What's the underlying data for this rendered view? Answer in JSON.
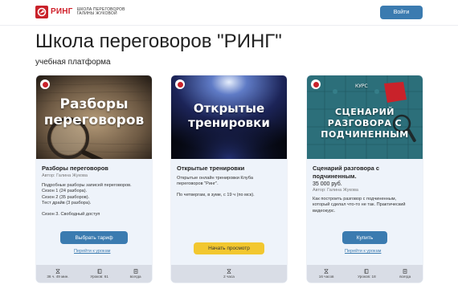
{
  "header": {
    "logo_main": "РИНГ",
    "logo_sub_line1": "ШКОЛА ПЕРЕГОВОРОВ",
    "logo_sub_line2": "ГАЛИНЫ ЖУКОВОЙ",
    "login_label": "Войти"
  },
  "page": {
    "title": "Школа переговоров \"РИНГ\"",
    "subtitle": "учебная платформа"
  },
  "cards": [
    {
      "cover_line1": "Разборы",
      "cover_line2": "переговоров",
      "title": "Разборы переговоров",
      "author": "Автор: Галина Жукова",
      "desc_lines": [
        "Подробные разборы записей переговоров.",
        "Сезон 1 (24 разбора).",
        "Сезон 2 (35 разборов).",
        "Тест драйв (3 разбора)."
      ],
      "desc_extra": "Сезон 3. Свободный доступ",
      "button_label": "Выбрать тариф",
      "link_label": "Перейти к урокам",
      "stats": [
        {
          "icon": "hourglass-icon",
          "label": "36 ч. 49 мин."
        },
        {
          "icon": "book-icon",
          "label": "Уроков: 61"
        },
        {
          "icon": "infinity-icon",
          "label": "всегда"
        }
      ]
    },
    {
      "cover_line1": "Открытые",
      "cover_line2": "тренировки",
      "title": "Открытые тренировки",
      "desc_lines": [
        "Открытые онлайн тренировки Клуба",
        "переговоров \"Ринг\"."
      ],
      "desc_extra": "По четвергам, в зуме, с 19 ч (по мск).",
      "button_label": "Начать просмотр",
      "stats": [
        {
          "icon": "hourglass-icon",
          "label": "2 часа"
        }
      ]
    },
    {
      "cover_badge": "КУРС",
      "cover_line1": "СЦЕНАРИЙ",
      "cover_line2": "РАЗГОВОРА С",
      "cover_line3": "ПОДЧИНЕННЫМ",
      "title_line1": "Сценарий разговора с",
      "title_line2": "подчиненным.",
      "price": "35 000 руб.",
      "author": "Автор: Галина Жукова",
      "desc_lines": [
        "Как построить разговор с подчиненным,",
        "который сделал что-то не так. Практический",
        "видеокурс."
      ],
      "button_label": "Купить",
      "link_label": "Перейти к урокам",
      "stats": [
        {
          "icon": "hourglass-icon",
          "label": "16 часов"
        },
        {
          "icon": "book-icon",
          "label": "Уроков: 18"
        },
        {
          "icon": "infinity-icon",
          "label": "всегда"
        }
      ]
    }
  ],
  "colors": {
    "accent": "#3b7bb0",
    "brand_red": "#d0202a",
    "yellow_button": "#f2c72f",
    "card_bg": "#eef3fa",
    "footer_bg": "#d9dde6"
  }
}
